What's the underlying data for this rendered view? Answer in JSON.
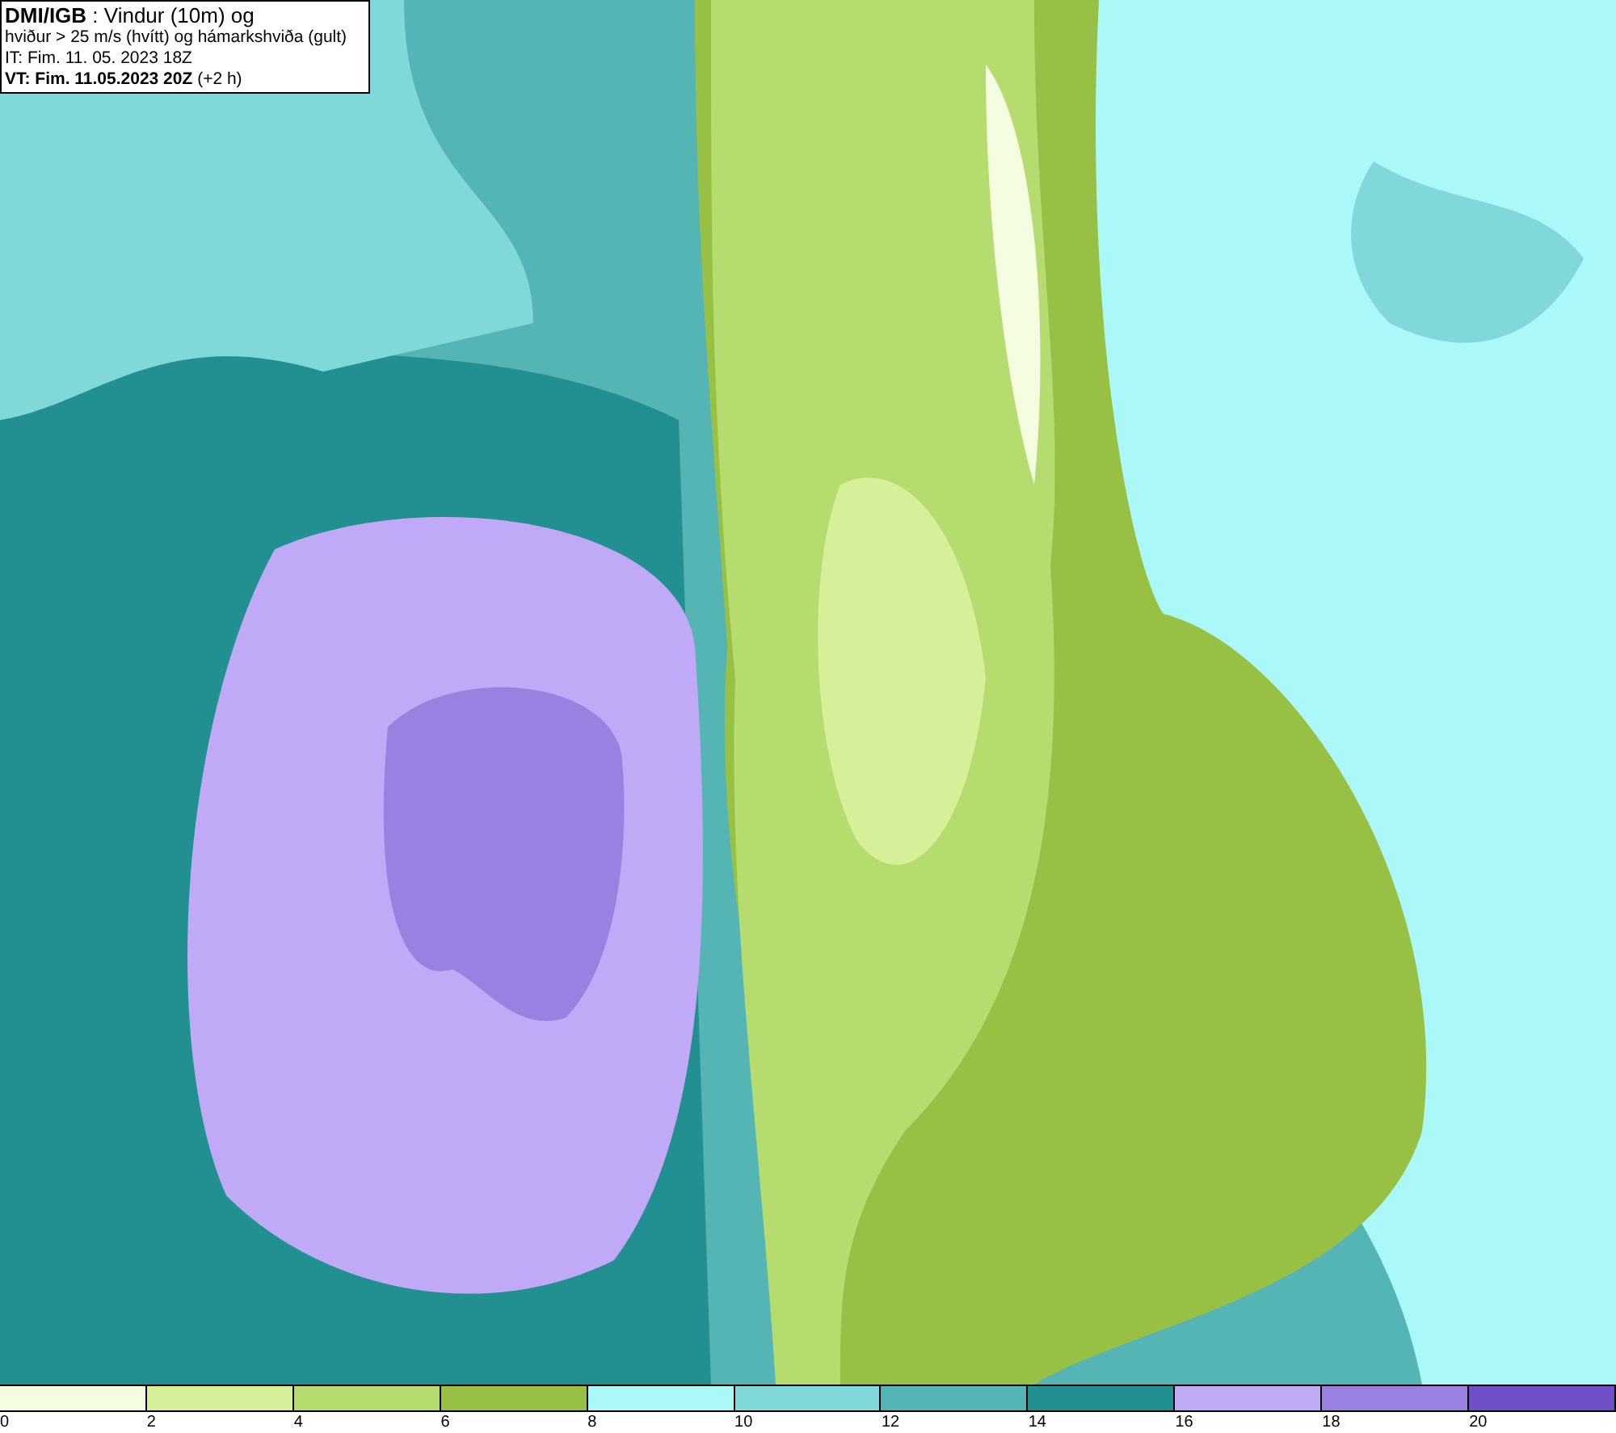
{
  "header": {
    "lines": [
      "**DMI/IGB** : Vindur (10m) og",
      "hviður > 25 m/s (hvítt) og hámarkshviða (gult)",
      "IT: Fim. 11. 05. 2023 18Z",
      "**VT: Fim. 11.05.2023 20Z** (+2 h)"
    ]
  },
  "legend": [
    {
      "label": "0",
      "color": "#f5fde0"
    },
    {
      "label": "2",
      "color": "#d6f09a"
    },
    {
      "label": "4",
      "color": "#b6dc70"
    },
    {
      "label": "6",
      "color": "#98c044"
    },
    {
      "label": "8",
      "color": "#aaf8f8"
    },
    {
      "label": "10",
      "color": "#80d8d8"
    },
    {
      "label": "12",
      "color": "#55b4b4"
    },
    {
      "label": "14",
      "color": "#229090"
    },
    {
      "label": "16",
      "color": "#c0aaf8"
    },
    {
      "label": "18",
      "color": "#9a80e0"
    },
    {
      "label": "20",
      "color": "#7050c8"
    }
  ]
}
